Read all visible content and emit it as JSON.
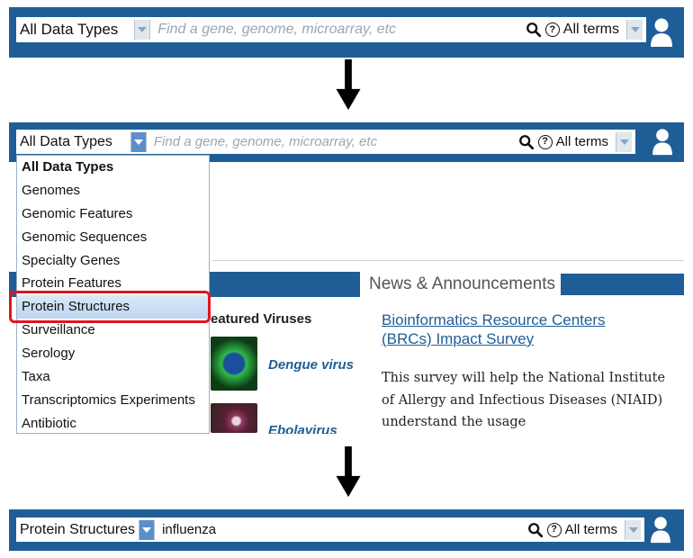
{
  "panel_top": {
    "data_type": "All Data Types",
    "search_placeholder": "Find a gene, genome, microarray, etc",
    "search_value": "",
    "terms_label": "All terms"
  },
  "panel_middle": {
    "data_type": "All Data Types",
    "search_placeholder": "Find a gene, genome, microarray, etc",
    "terms_label": "All terms",
    "dropdown_items": [
      "All Data Types",
      "Genomes",
      "Genomic Features",
      "Genomic Sequences",
      "Specialty Genes",
      "Protein Features",
      "Protein Structures",
      "Surveillance",
      "Serology",
      "Taxa",
      "Transcriptomics Experiments",
      "Antibiotic"
    ],
    "selected_item": "Protein Structures",
    "featured_heading": "eatured Viruses",
    "viruses": [
      "Dengue virus",
      "Ebolavirus"
    ],
    "news_heading": "News & Announcements",
    "news_link": "Bioinformatics Resource Centers (BRCs) Impact Survey",
    "news_text": "This survey will help the National Institute of Allergy and Infectious Diseases (NIAID) understand the usage"
  },
  "panel_bottom": {
    "data_type": "Protein Structures",
    "search_value": "influenza",
    "terms_label": "All terms"
  },
  "icons": [
    "search-icon",
    "help-icon",
    "user-icon",
    "chevron-down-icon",
    "arrow-down-icon"
  ],
  "colors": {
    "bar_blue": "#1f5d97",
    "highlight_red": "#e2141e",
    "link_blue": "#1f5d97"
  }
}
